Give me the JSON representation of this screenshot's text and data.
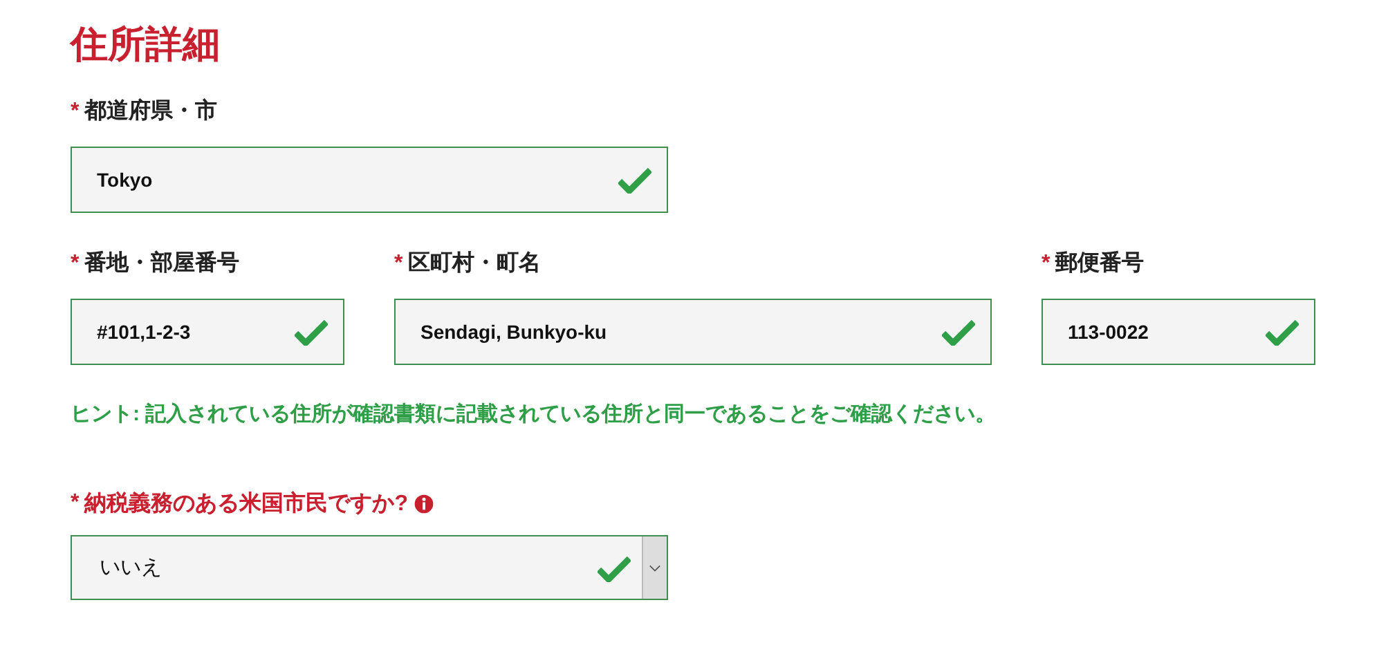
{
  "title": "住所詳細",
  "rows": [
    {
      "fields": [
        {
          "mark": "*",
          "label": "都道府県・市",
          "value": "Tokyo",
          "valid": true
        }
      ]
    },
    {
      "fields": [
        {
          "mark": "*",
          "label": "番地・部屋番号",
          "value": "#101,1-2-3",
          "valid": true
        },
        {
          "mark": "*",
          "label": "区町村・町名",
          "value": "Sendagi, Bunkyo-ku",
          "valid": true
        },
        {
          "mark": "*",
          "label": "郵便番号",
          "value": "113-0022",
          "valid": true
        }
      ]
    }
  ],
  "hint": "ヒント: 記入されている住所が確認書類に記載されている住所と同一であることをご確認ください。",
  "question": {
    "mark": "*",
    "label": "納税義務のある米国市民ですか?",
    "info": true,
    "value": "いいえ",
    "valid": true
  }
}
